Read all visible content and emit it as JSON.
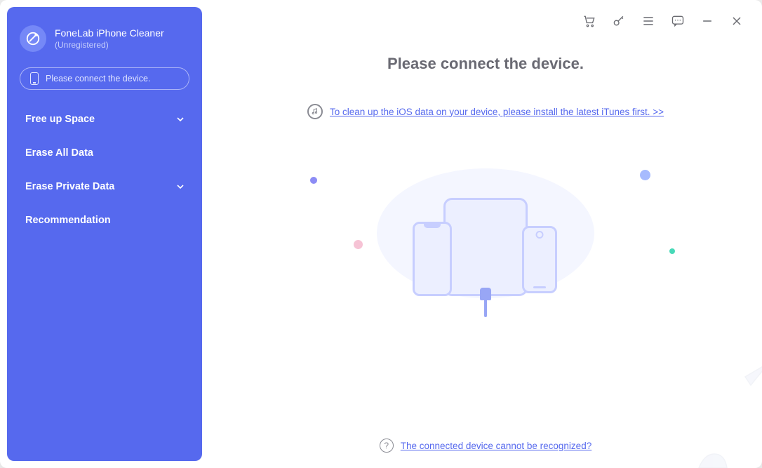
{
  "brand": {
    "title": "FoneLab iPhone Cleaner",
    "subtitle": "(Unregistered)"
  },
  "connect_pill": "Please connect the device.",
  "nav": {
    "items": [
      {
        "label": "Free up Space",
        "expandable": true
      },
      {
        "label": "Erase All Data",
        "expandable": false
      },
      {
        "label": "Erase Private Data",
        "expandable": true
      },
      {
        "label": "Recommendation",
        "expandable": false
      }
    ]
  },
  "main": {
    "heading": "Please connect the device.",
    "itunes_link": "To clean up the iOS data on your device, please install the latest iTunes first. >>",
    "footer_link": "The connected device cannot be recognized?"
  },
  "titlebar": {
    "cart": "cart",
    "key": "key",
    "menu": "menu",
    "feedback": "feedback",
    "minimize": "minimize",
    "close": "close"
  }
}
